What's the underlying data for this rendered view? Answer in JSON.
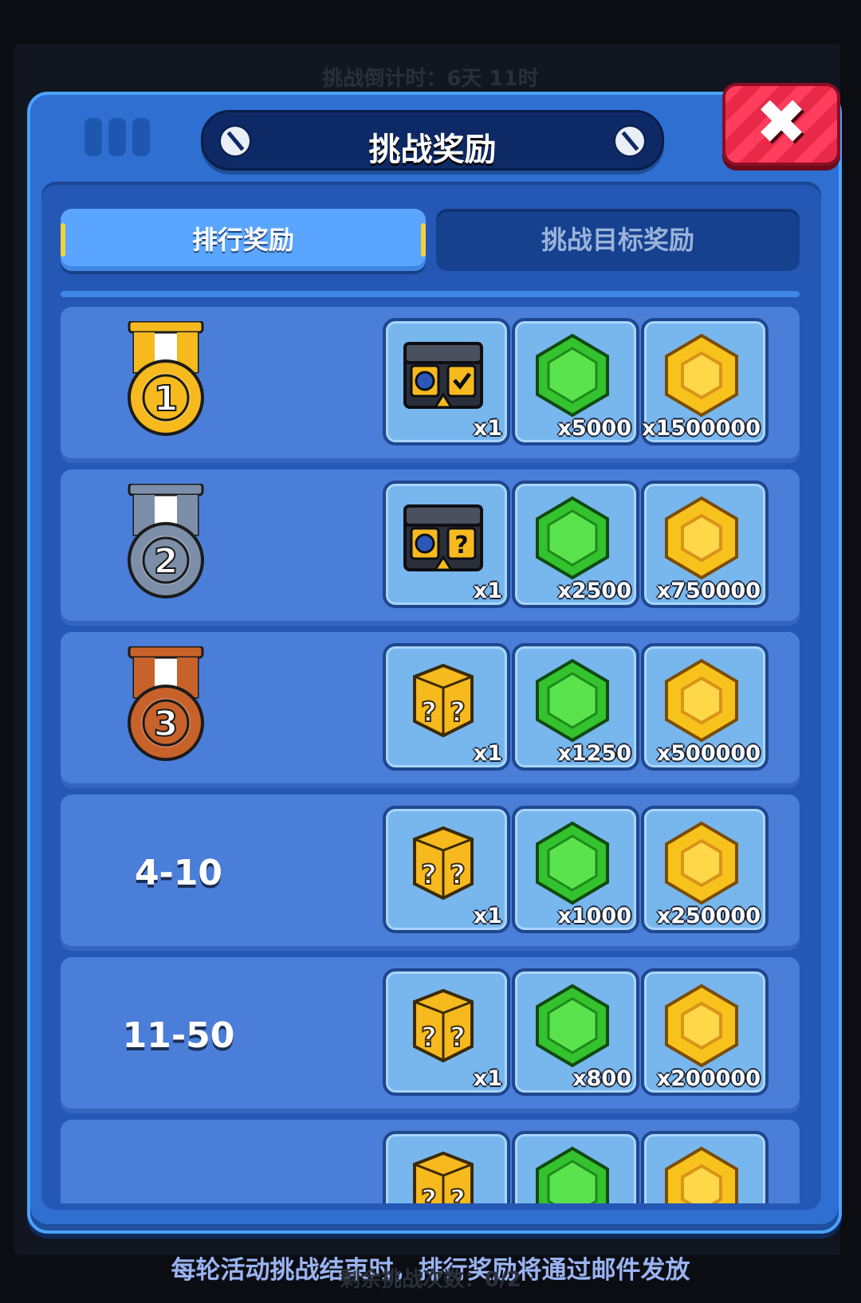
{
  "background": {
    "countdown_text": "挑战倒计时：6天 11时",
    "remaining_text": "剩余挑战次数：0/2"
  },
  "dialog": {
    "title": "挑战奖励",
    "close_label": "✖",
    "tabs": [
      {
        "label": "排行奖励",
        "active": true
      },
      {
        "label": "挑战目标奖励",
        "active": false
      }
    ]
  },
  "rows": [
    {
      "rank": "1",
      "rank_label": "",
      "medal": "gold-medal-icon",
      "rewards": [
        {
          "icon": "reward-chest-icon",
          "qty": "x1"
        },
        {
          "icon": "green-gem-icon",
          "qty": "x5000"
        },
        {
          "icon": "gold-coin-icon",
          "qty": "x1500000"
        }
      ]
    },
    {
      "rank": "2",
      "rank_label": "",
      "medal": "silver-medal-icon",
      "rewards": [
        {
          "icon": "mystery-chest-icon",
          "qty": "x1"
        },
        {
          "icon": "green-gem-icon",
          "qty": "x2500"
        },
        {
          "icon": "gold-coin-icon",
          "qty": "x750000"
        }
      ]
    },
    {
      "rank": "3",
      "rank_label": "",
      "medal": "bronze-medal-icon",
      "rewards": [
        {
          "icon": "lucky-box-icon",
          "qty": "x1"
        },
        {
          "icon": "green-gem-icon",
          "qty": "x1250"
        },
        {
          "icon": "gold-coin-icon",
          "qty": "x500000"
        }
      ]
    },
    {
      "rank": "",
      "rank_label": "4-10",
      "medal": "",
      "rewards": [
        {
          "icon": "lucky-box-icon",
          "qty": "x1"
        },
        {
          "icon": "green-gem-icon",
          "qty": "x1000"
        },
        {
          "icon": "gold-coin-icon",
          "qty": "x250000"
        }
      ]
    },
    {
      "rank": "",
      "rank_label": "11-50",
      "medal": "",
      "rewards": [
        {
          "icon": "lucky-box-icon",
          "qty": "x1"
        },
        {
          "icon": "green-gem-icon",
          "qty": "x800"
        },
        {
          "icon": "gold-coin-icon",
          "qty": "x200000"
        }
      ]
    },
    {
      "rank": "",
      "rank_label": "",
      "medal": "",
      "rewards": [
        {
          "icon": "lucky-box-icon",
          "qty": ""
        },
        {
          "icon": "green-gem-icon",
          "qty": ""
        },
        {
          "icon": "gold-coin-icon",
          "qty": ""
        }
      ]
    }
  ],
  "colors": {
    "gold": "#f6b91e",
    "silver": "#7d8fa8",
    "bronze": "#c8622b",
    "gem": "#35c22f",
    "coin": "#f8c21c"
  },
  "footer": {
    "note": "每轮活动挑战结束时，排行奖励将通过邮件发放"
  }
}
